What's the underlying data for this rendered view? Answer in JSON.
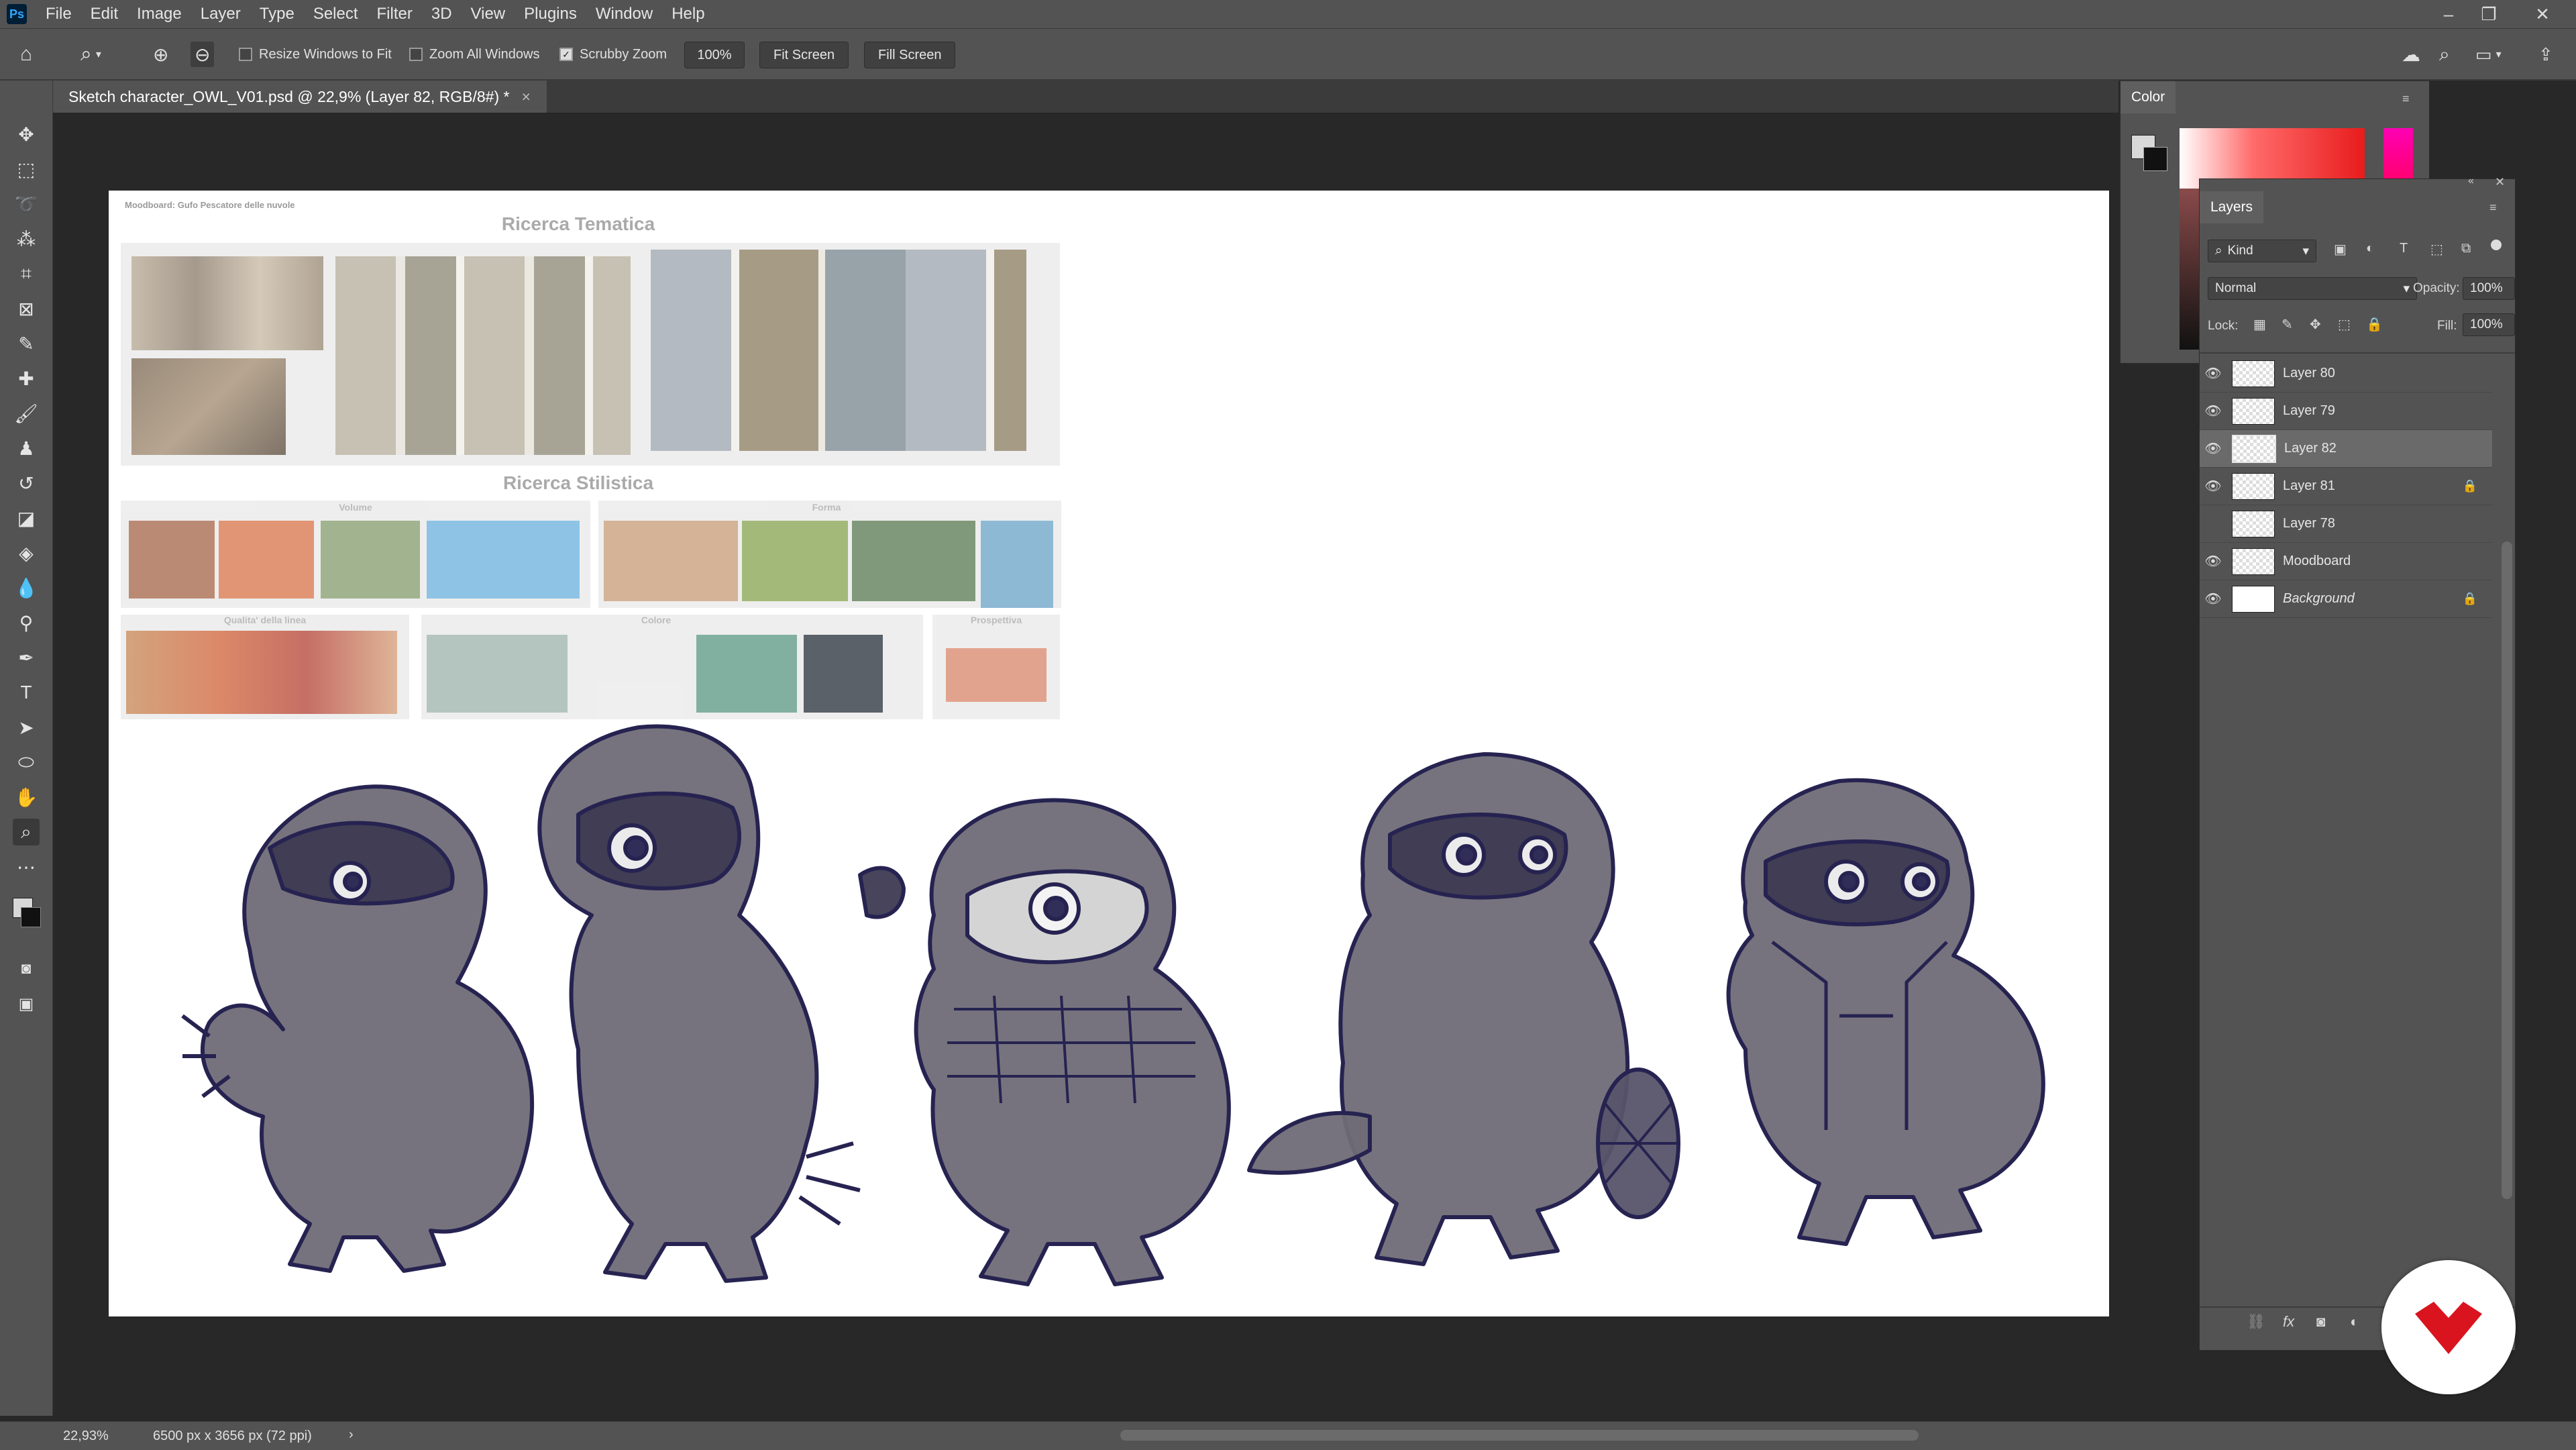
{
  "menubar": {
    "logo": "Ps",
    "items": [
      "File",
      "Edit",
      "Image",
      "Layer",
      "Type",
      "Select",
      "Filter",
      "3D",
      "View",
      "Plugins",
      "Window",
      "Help"
    ]
  },
  "options": {
    "resize_windows": "Resize Windows to Fit",
    "zoom_all": "Zoom All Windows",
    "scrubby_zoom": "Scrubby Zoom",
    "zoom_value": "100%",
    "fit_screen": "Fit Screen",
    "fill_screen": "Fill Screen",
    "resize_checked": false,
    "zoom_all_checked": false,
    "scrubby_checked": true
  },
  "document": {
    "tab_title": "Sketch character_OWL_V01.psd @ 22,9% (Layer 82, RGB/8#) *",
    "close": "×"
  },
  "moodboard": {
    "caption": "Moodboard: Gufo Pescatore delle nuvole",
    "title_tematica": "Ricerca Tematica",
    "title_stilistica": "Ricerca Stilistica",
    "label_volume": "Volume",
    "label_forma": "Forma",
    "label_linea": "Qualita' della linea",
    "label_colore": "Colore",
    "label_prospettiva": "Prospettiva"
  },
  "status": {
    "zoom": "22,93%",
    "size": "6500 px x 3656 px (72 ppi)"
  },
  "color_panel": {
    "title": "Color"
  },
  "layers_panel": {
    "title": "Layers",
    "filter": "Kind",
    "blend_mode": "Normal",
    "opacity_label": "Opacity:",
    "opacity_value": "100%",
    "lock_label": "Lock:",
    "fill_label": "Fill:",
    "fill_value": "100%",
    "layers": [
      {
        "name": "Layer 80",
        "visible": true,
        "locked": false,
        "selected": false
      },
      {
        "name": "Layer 79",
        "visible": true,
        "locked": false,
        "selected": false
      },
      {
        "name": "Layer 82",
        "visible": true,
        "locked": false,
        "selected": true
      },
      {
        "name": "Layer 81",
        "visible": true,
        "locked": true,
        "selected": false
      },
      {
        "name": "Layer 78",
        "visible": false,
        "locked": false,
        "selected": false
      },
      {
        "name": "Moodboard",
        "visible": true,
        "locked": false,
        "selected": false
      },
      {
        "name": "Background",
        "visible": true,
        "locked": true,
        "selected": false
      }
    ]
  },
  "colors": {
    "accent": "#31a8ff",
    "badge_red": "#d9141e",
    "sketch_fill": "#6f6c77",
    "sketch_line": "#262351"
  }
}
